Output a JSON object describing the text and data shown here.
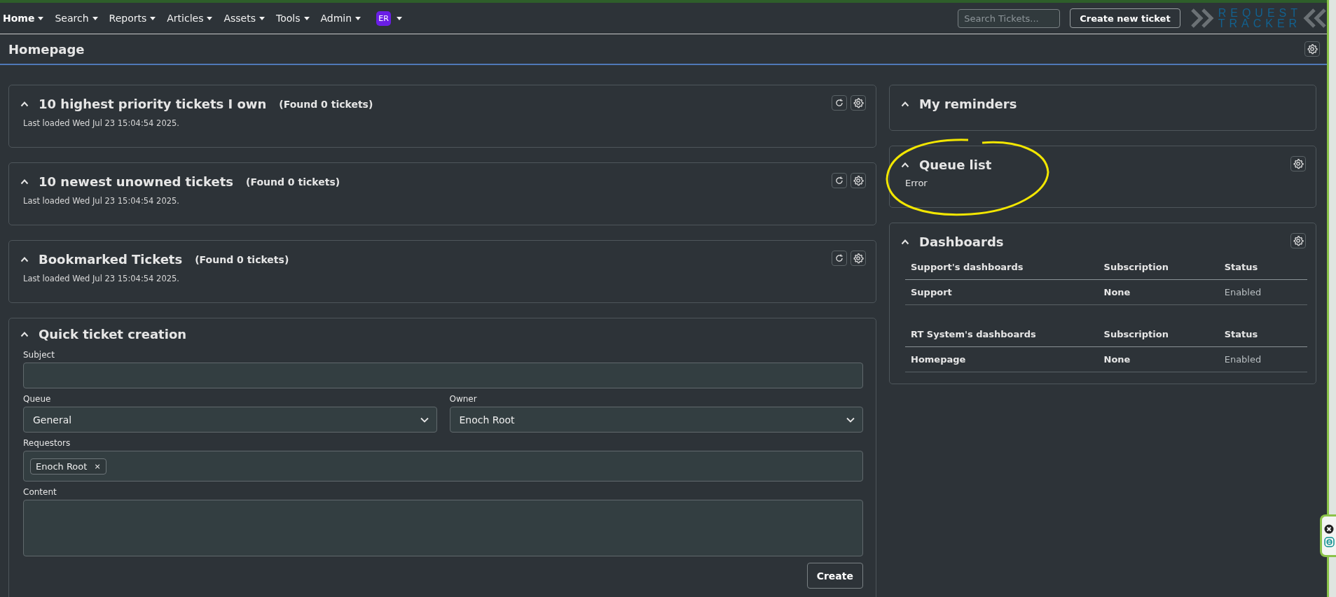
{
  "nav": {
    "items": [
      {
        "label": "Home",
        "selected": true
      },
      {
        "label": "Search",
        "selected": false
      },
      {
        "label": "Reports",
        "selected": false
      },
      {
        "label": "Articles",
        "selected": false
      },
      {
        "label": "Assets",
        "selected": false
      },
      {
        "label": "Tools",
        "selected": false
      },
      {
        "label": "Admin",
        "selected": false
      }
    ],
    "avatar": "ER",
    "search": {
      "placeholder": "Search Tickets..."
    },
    "create_button": "Create new ticket",
    "logo": {
      "line_1": "REQUEST",
      "line_2": "TRACKER"
    }
  },
  "page": {
    "title": "Homepage"
  },
  "left_panels": [
    {
      "title": "10 highest priority tickets I own",
      "count": "(Found 0 tickets)",
      "last_loaded": "Last loaded Wed Jul 23 15:04:54 2025."
    },
    {
      "title": "10 newest unowned tickets",
      "count": "(Found 0 tickets)",
      "last_loaded": "Last loaded Wed Jul 23 15:04:54 2025."
    },
    {
      "title": "Bookmarked Tickets",
      "count": "(Found 0 tickets)",
      "last_loaded": "Last loaded Wed Jul 23 15:04:54 2025."
    }
  ],
  "quick_create": {
    "title": "Quick ticket creation",
    "fields": [
      {
        "kind": "text",
        "label": "Subject"
      },
      {
        "kind": "select",
        "label": "Queue",
        "value": "General"
      },
      {
        "kind": "select",
        "label": "Owner",
        "value": "Enoch Root"
      },
      {
        "kind": "tags",
        "label": "Requestors",
        "tags": [
          {
            "label": "Enoch Root",
            "remove": "×"
          }
        ]
      },
      {
        "kind": "textarea",
        "label": "Content"
      }
    ],
    "submit": "Create"
  },
  "right_panels": [
    {
      "title": "My reminders",
      "settings": false
    },
    {
      "title": "Queue list",
      "settings": true,
      "message": "Error",
      "highlighted": true
    },
    {
      "title": "Dashboards",
      "settings": true,
      "tables": [
        {
          "columns": [
            "Support's dashboards",
            "Subscription",
            "Status"
          ],
          "rows": [
            [
              "Support",
              "None",
              "Enabled"
            ]
          ]
        },
        {
          "columns": [
            "RT System's dashboards",
            "Subscription",
            "Status"
          ],
          "rows": [
            [
              "Homepage",
              "None",
              "Enabled"
            ]
          ]
        }
      ]
    }
  ]
}
